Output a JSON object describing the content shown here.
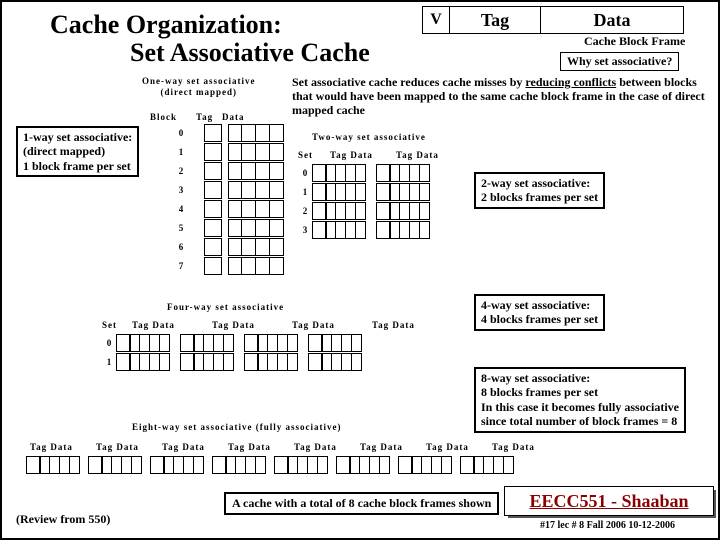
{
  "title_line1": "Cache Organization:",
  "title_line2": "Set Associative Cache",
  "vtd": {
    "v": "V",
    "tag": "Tag",
    "data": "Data",
    "frame": "Cache Block Frame",
    "why": "Why set associative?"
  },
  "desc": "Set associative cache reduces cache misses by <u>reducing conflicts</u> between blocks that would have been mapped to the same cache block frame in the case of direct mapped cache",
  "oneway": {
    "label": "One-way set associative",
    "sub": "(direct mapped)",
    "block": "Block",
    "tag": "Tag",
    "data": "Data",
    "rows": [
      "0",
      "1",
      "2",
      "3",
      "4",
      "5",
      "6",
      "7"
    ]
  },
  "box1": "1-way set associative:<br>(direct mapped)<br>1 block frame per set",
  "twoway": {
    "label": "Two-way set associative",
    "set": "Set",
    "td1": "Tag  Data",
    "td2": "Tag  Data",
    "rows": [
      "0",
      "1",
      "2",
      "3"
    ]
  },
  "box2": "2-way set associative:<br>2 blocks frames per set",
  "fourway": {
    "label": "Four-way set associative",
    "set": "Set",
    "td": "Tag  Data",
    "rows": [
      "0",
      "1"
    ]
  },
  "box4": "4-way set associative:<br>4 blocks frames per set",
  "eightway": {
    "label": "Eight-way set associative (fully associative)",
    "td": "Tag  Data"
  },
  "box8": "8-way set associative:<br>8 blocks frames per set<br>In this case it becomes fully associative<br>since total number of block frames = 8",
  "footbox": "A cache with a total of 8 cache block frames shown",
  "review": "(Review from 550)",
  "eecc": "EECC551 - Shaaban",
  "lec": "#17  lec  # 8   Fall 2006  10-12-2006"
}
